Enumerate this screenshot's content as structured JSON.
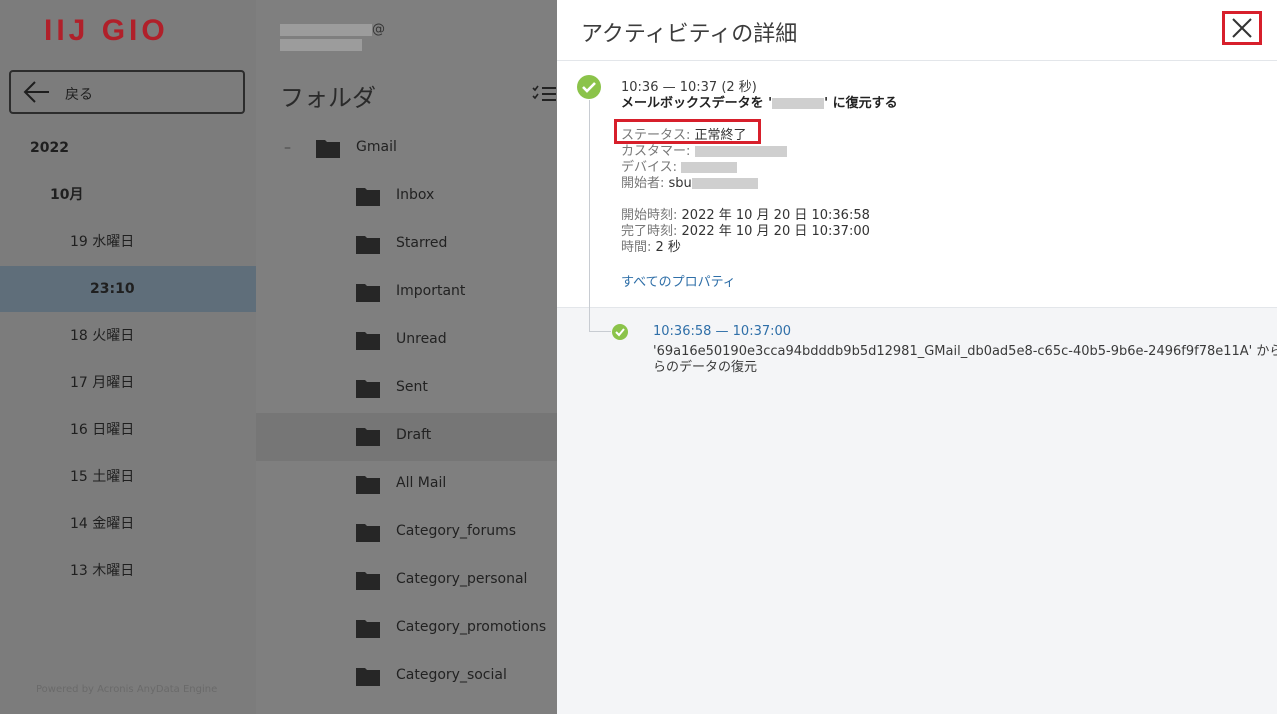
{
  "sidebar": {
    "logo": "IIJ GIO",
    "back_label": "戻る",
    "tree": [
      {
        "label": "2022",
        "level": 0
      },
      {
        "label": "10月",
        "level": 1
      },
      {
        "label": "19 水曜日",
        "level": 2
      },
      {
        "label": "23:10",
        "level": 3,
        "selected": true
      },
      {
        "label": "18 火曜日",
        "level": 2
      },
      {
        "label": "17 月曜日",
        "level": 2
      },
      {
        "label": "16 日曜日",
        "level": 2
      },
      {
        "label": "15 土曜日",
        "level": 2
      },
      {
        "label": "14 金曜日",
        "level": 2
      },
      {
        "label": "13 木曜日",
        "level": 2
      }
    ],
    "powered_by": "Powered by Acronis AnyData Engine"
  },
  "middle": {
    "account_at": "@",
    "folders_title": "フォルダ",
    "root_folder": "Gmail",
    "folders": [
      "Inbox",
      "Starred",
      "Important",
      "Unread",
      "Sent",
      "Draft",
      "All Mail",
      "Category_forums",
      "Category_personal",
      "Category_promotions",
      "Category_social"
    ],
    "highlighted_folder": "Draft"
  },
  "panel": {
    "title": "アクティビティの詳細",
    "activity": {
      "time_range": "10:36 — 10:37 (2 秒)",
      "summary_prefix": "メールボックスデータを '",
      "summary_suffix": "' に復元する",
      "status_label": "ステータス:",
      "status_value": "正常終了",
      "customer_label": "カスタマー:",
      "device_label": "デバイス:",
      "started_by_label": "開始者:",
      "started_by_value": "sbu",
      "start_label": "開始時刻:",
      "start_value": "2022 年 10 月 20 日 10:36:58",
      "end_label": "完了時刻:",
      "end_value": "2022 年 10 月 20 日 10:37:00",
      "duration_label": "時間:",
      "duration_value": "2 秒",
      "all_properties": "すべてのプロパティ"
    },
    "sub_activity": {
      "time_range": "10:36:58 — 10:37:00",
      "text_line1": "'69a16e50190e3cca94bdddb9b5d12981_GMail_db0ad5e8-c65c-40b5-9b6e-2496f9f78e11A' から",
      "text_line2": "らのデータの復元"
    }
  },
  "colors": {
    "highlight_red": "#d71f2b",
    "success_green": "#8bc34a",
    "link_blue": "#2f6fa8",
    "logo_red": "#b0202a"
  }
}
